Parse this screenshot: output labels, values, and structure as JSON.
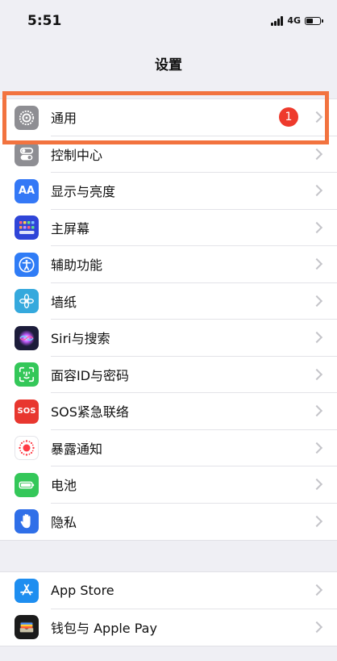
{
  "status_bar": {
    "time": "5:51",
    "network": "4G"
  },
  "nav": {
    "title": "设置"
  },
  "groups": [
    {
      "items": [
        {
          "label": "通用",
          "icon": "gear-icon",
          "color": "#8e8e93",
          "badge": "1"
        },
        {
          "label": "控制中心",
          "icon": "toggle-switches-icon",
          "color": "#8e8e93"
        },
        {
          "label": "显示与亮度",
          "icon": "text-size-icon",
          "color": "#3478f6",
          "glyph": "AA"
        },
        {
          "label": "主屏幕",
          "icon": "app-grid-icon",
          "color": "#2f45d8"
        },
        {
          "label": "辅助功能",
          "icon": "accessibility-icon",
          "color": "#2f7cf6"
        },
        {
          "label": "墙纸",
          "icon": "wallpaper-flower-icon",
          "color": "#35a9dd"
        },
        {
          "label": "Siri与搜索",
          "icon": "siri-icon",
          "color": "#1c1c3a"
        },
        {
          "label": "面容ID与密码",
          "icon": "face-id-icon",
          "color": "#34c759"
        },
        {
          "label": "SOS紧急联络",
          "icon": "sos-icon",
          "color": "#e8372f",
          "glyph": "SOS"
        },
        {
          "label": "暴露通知",
          "icon": "exposure-notification-icon",
          "color": "#ffffff"
        },
        {
          "label": "电池",
          "icon": "battery-icon",
          "color": "#34c759"
        },
        {
          "label": "隐私",
          "icon": "hand-icon",
          "color": "#2f6fe8"
        }
      ]
    },
    {
      "items": [
        {
          "label": "App Store",
          "icon": "app-store-icon",
          "color": "#1e8ef0"
        },
        {
          "label": "钱包与 Apple Pay",
          "icon": "wallet-icon",
          "color": "#1b1b1b"
        }
      ]
    }
  ],
  "highlight_color": "#f2733f"
}
